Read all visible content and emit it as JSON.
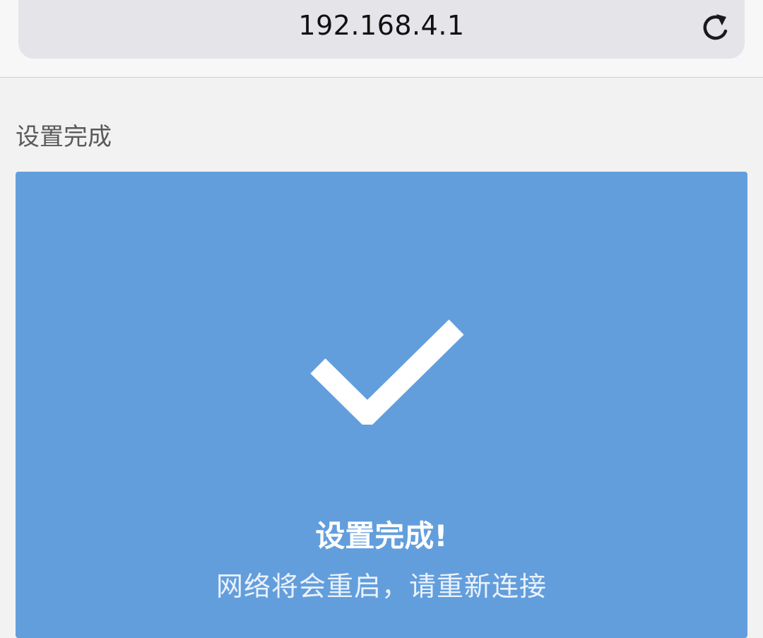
{
  "browser": {
    "url": "192.168.4.1",
    "reload_icon": "reload-icon"
  },
  "page": {
    "heading": "设置完成"
  },
  "card": {
    "background": "#639edc",
    "icon": "checkmark-icon",
    "title": "设置完成!",
    "message": "网络将会重启，请重新连接"
  }
}
